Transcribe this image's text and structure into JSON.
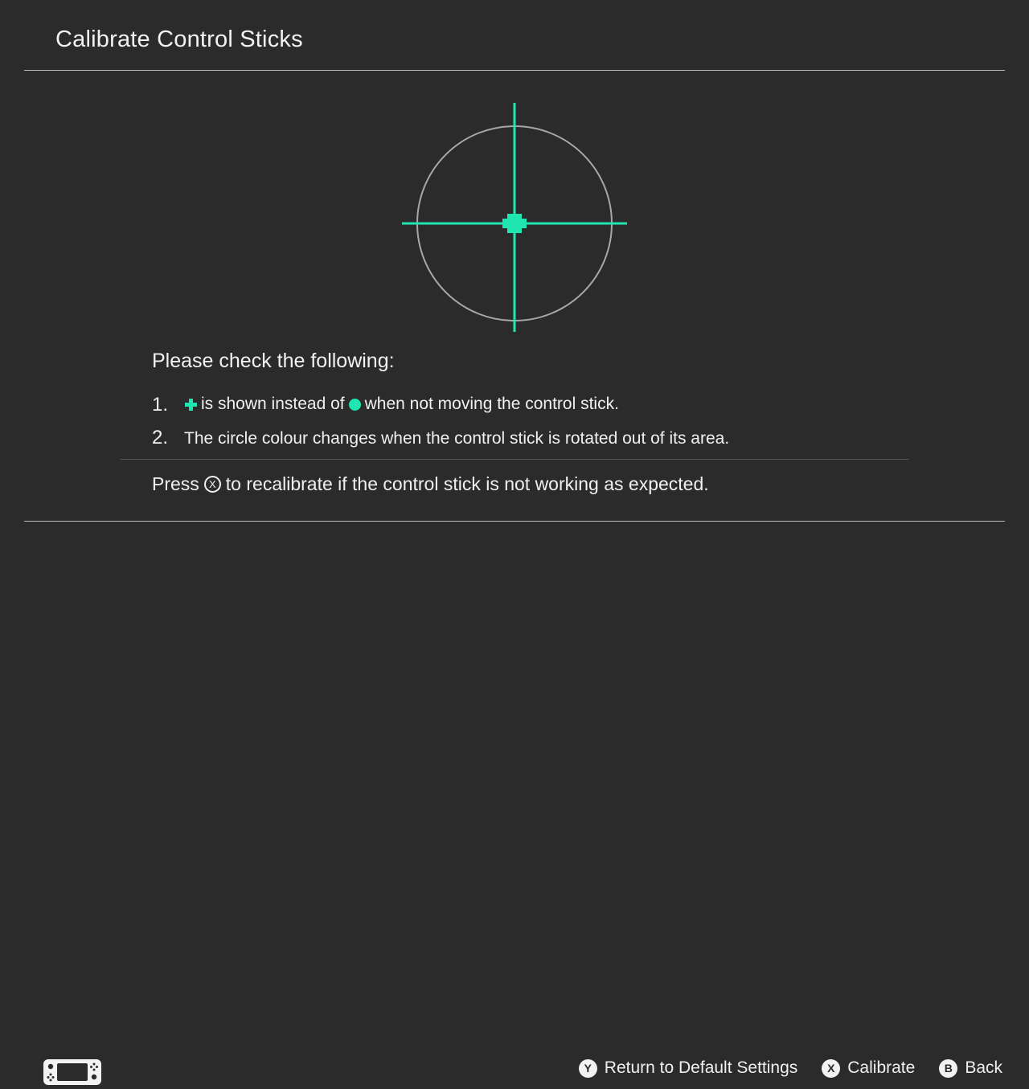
{
  "screen": {
    "title": "Calibrate Control Sticks",
    "background_color": "#2b2b2b",
    "accent_color": "#1FE5B0",
    "text_color": "#f0f0f0",
    "rule_color": "#b9b9b9"
  },
  "stick_visualizer": {
    "circle_color": "#a8a8a8",
    "crosshair_color": "#1FE5B0",
    "indicator_shape": "plus",
    "position_x": 0,
    "position_y": 0
  },
  "instructions": {
    "heading": "Please check the following:",
    "items": [
      {
        "number": "1.",
        "pre_text": "",
        "icon_a": "plus-icon",
        "mid_text": "is shown instead of",
        "icon_b": "dot-icon",
        "post_text": "when not moving the control stick."
      },
      {
        "number": "2.",
        "text": "The circle colour changes when the control stick is rotated out of its area."
      }
    ]
  },
  "recalibrate_note": {
    "prefix": "Press",
    "button": "X",
    "suffix": "to recalibrate if the control stick is not working as expected."
  },
  "footer": {
    "device_icon": "switch-console-icon",
    "hints": [
      {
        "button": "Y",
        "label": "Return to Default Settings"
      },
      {
        "button": "X",
        "label": "Calibrate"
      },
      {
        "button": "B",
        "label": "Back"
      }
    ]
  }
}
